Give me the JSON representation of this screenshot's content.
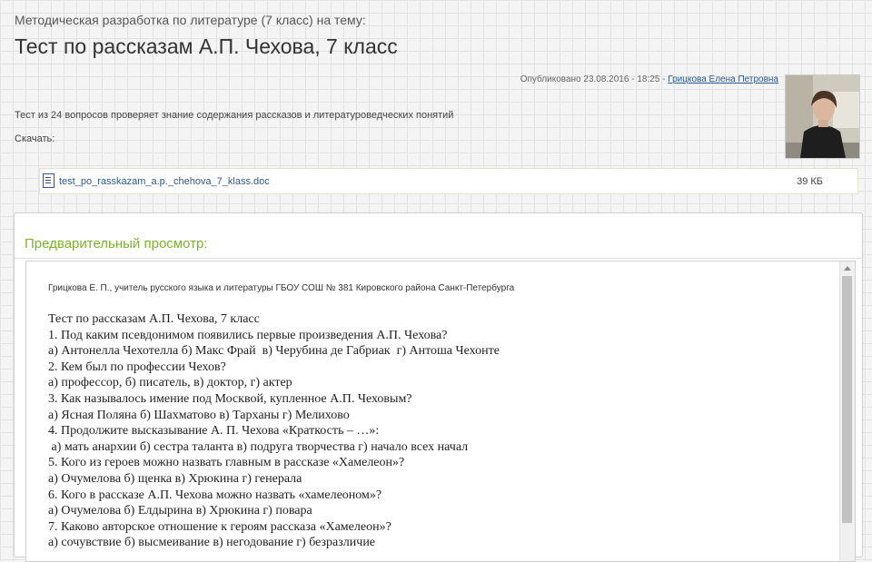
{
  "page": {
    "subtitle": "Методическая разработка по литературе (7 класс) на тему:",
    "title": "Тест по рассказам А.П. Чехова, 7 класс",
    "meta_prefix": "Опубликовано 23.08.2016 - 18:25 - ",
    "author": "Грицкова Елена Петровна",
    "intro": "Тест из 24 вопросов проверяет знание содержания  рассказов и литературоведческих понятий",
    "download_label": "Скачать:"
  },
  "file": {
    "name": "test_po_rasskazam_a.p._chehova_7_klass.doc",
    "size": "39 КБ",
    "icon": "word-doc-icon"
  },
  "preview": {
    "heading": "Предварительный просмотр:",
    "doc_author": "Грицкова Е. П., учитель русского языка и литературы ГБОУ СОШ № 381 Кировского района Санкт-Петербурга",
    "lines": [
      "Тест по рассказам А.П. Чехова, 7 класс",
      "1. Под каким псевдонимом появились первые произведения А.П. Чехова?",
      "а) Антонелла Чехотелла б) Макс Фрай  в) Черубина де Габриак  г) Антоша Чехонте",
      "2. Кем был по профессии Чехов?",
      "а) профессор, б) писатель, в) доктор, г) актер",
      "3. Как называлось имение под Москвой, купленное А.П. Чеховым?",
      "а) Ясная Поляна б) Шахматово в) Тарханы г) Мелихово",
      "4. Продолжите высказывание А. П. Чехова «Краткость – …»:",
      " а) мать анархии б) сестра таланта в) подруга творчества г) начало всех начал",
      "5. Кого из героев можно назвать главным в рассказе «Хамелеон»?",
      "а) Очумелова б) щенка в) Хрюкина г) генерала",
      "6. Кого в рассказе А.П. Чехова можно назвать «хамелеоном»?",
      "а) Очумелова б) Елдырина в) Хрюкина г) повара",
      "7. Каково авторское отношение к героям рассказа «Хамелеон»?",
      "а) сочувствие б) высмеивание в) негодование г) безразличие"
    ]
  }
}
